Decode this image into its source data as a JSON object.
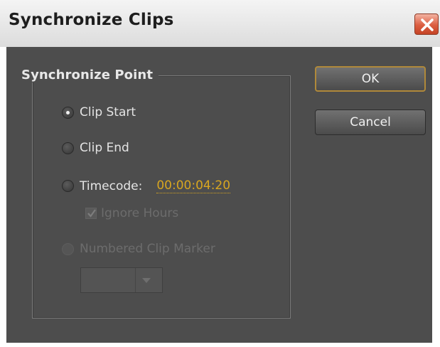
{
  "dialog": {
    "title": "Synchronize Clips",
    "close_icon": "close-icon"
  },
  "group": {
    "title": "Synchronize Point"
  },
  "options": {
    "clip_start": {
      "label": "Clip Start",
      "selected": true,
      "enabled": true
    },
    "clip_end": {
      "label": "Clip End",
      "selected": false,
      "enabled": true
    },
    "timecode": {
      "label": "Timecode:",
      "value": "00:00:04:20",
      "selected": false,
      "enabled": true
    },
    "ignore_hours": {
      "label": "Ignore Hours",
      "checked": true,
      "enabled": false
    },
    "numbered_marker": {
      "label": "Numbered Clip Marker",
      "selected": false,
      "enabled": false
    }
  },
  "marker_select": {
    "value": "",
    "enabled": false
  },
  "buttons": {
    "ok": "OK",
    "cancel": "Cancel"
  },
  "colors": {
    "panel": "#4d4d4d",
    "timecode": "#d8a620",
    "default_button_border": "#b0893a",
    "close_button": "#dc5e41"
  }
}
